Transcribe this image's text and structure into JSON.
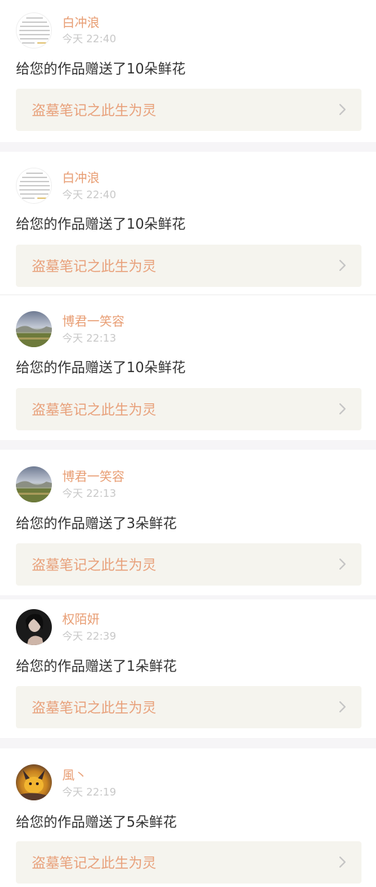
{
  "items": [
    {
      "user": "白冲浪",
      "time": "今天 22:40",
      "message": "给您的作品赠送了10朵鲜花",
      "work_title": "盗墓笔记之此生为灵",
      "avatar_icon": "text-screenshot-avatar"
    },
    {
      "user": "白冲浪",
      "time": "今天 22:40",
      "message": "给您的作品赠送了10朵鲜花",
      "work_title": "盗墓笔记之此生为灵",
      "avatar_icon": "text-screenshot-avatar"
    },
    {
      "user": "博君一笑容",
      "time": "今天 22:13",
      "message": "给您的作品赠送了10朵鲜花",
      "work_title": "盗墓笔记之此生为灵",
      "avatar_icon": "landscape-avatar"
    },
    {
      "user": "博君一笑容",
      "time": "今天 22:13",
      "message": "给您的作品赠送了3朵鲜花",
      "work_title": "盗墓笔记之此生为灵",
      "avatar_icon": "landscape-avatar"
    },
    {
      "user": "权陌妍",
      "time": "今天 22:39",
      "message": "给您的作品赠送了1朵鲜花",
      "work_title": "盗墓笔记之此生为灵",
      "avatar_icon": "portrait-avatar"
    },
    {
      "user": "風丶",
      "time": "今天 22:19",
      "message": "给您的作品赠送了5朵鲜花",
      "work_title": "盗墓笔记之此生为灵",
      "avatar_icon": "cartoon-avatar"
    }
  ],
  "colors": {
    "username": "#e89e74",
    "timestamp": "#c8c8c8",
    "message": "#333333",
    "card_background": "#f5f4ee",
    "work_title": "#e8a07a",
    "separator": "#f6f5f7"
  }
}
